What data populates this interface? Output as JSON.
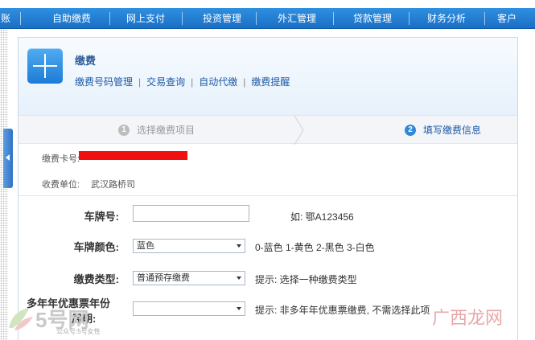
{
  "topnav": {
    "items": [
      "账",
      "自助缴费",
      "网上支付",
      "投资管理",
      "外汇管理",
      "贷款管理",
      "财务分析",
      "客户"
    ]
  },
  "header": {
    "title": "缴费",
    "subnav": [
      "缴费号码管理",
      "交易查询",
      "自动代缴",
      "缴费提醒"
    ]
  },
  "steps": [
    {
      "num": "1",
      "label": "选择缴费项目"
    },
    {
      "num": "2",
      "label": "填写缴费信息"
    }
  ],
  "info": {
    "card_label": "缴费卡号:",
    "payee_label": "收费单位:",
    "payee_value": "武汉路桥司"
  },
  "form": {
    "plate_label": "车牌号:",
    "plate_value": "",
    "plate_hint": "如: 鄂A123456",
    "color_label": "车牌颜色:",
    "color_value": "蓝色",
    "color_hint": "0-蓝色 1-黄色 2-黑色 3-白色",
    "type_label": "缴费类型:",
    "type_value": "普通预存缴费",
    "type_hint": "提示: 选择一种缴费类型",
    "multi_label_1": "多年年优惠票年份",
    "multi_label_2": "周期:",
    "multi_value": "",
    "multi_hint": "提示: 非多年年优惠票缴费, 不需选择此项"
  },
  "watermarks": {
    "left_brand": "5号网",
    "left_sub": "公众号:5号女性",
    "right": "广西龙网"
  },
  "colors": {
    "nav_bg": "#1f7dd3",
    "accent": "#1d5aa6",
    "redaction": "#f01010"
  }
}
